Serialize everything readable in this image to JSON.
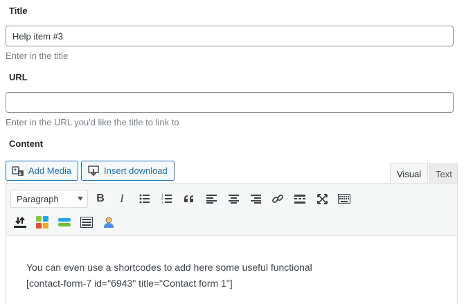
{
  "title_field": {
    "label": "Title",
    "value": "Help item #3",
    "hint": "Enter in the title"
  },
  "url_field": {
    "label": "URL",
    "value": "",
    "hint": "Enter in the URL you'd like the title to link to"
  },
  "content_field": {
    "label": "Content"
  },
  "media_buttons": {
    "add_media": "Add Media",
    "insert_download": "Insert download"
  },
  "editor_tabs": {
    "visual": "Visual",
    "text": "Text",
    "active": "visual"
  },
  "toolbar": {
    "format_select": "Paragraph",
    "row1_icons": [
      "bold-icon",
      "italic-icon",
      "bulleted-list-icon",
      "numbered-list-icon",
      "blockquote-icon",
      "align-left-icon",
      "align-center-icon",
      "align-right-icon",
      "link-icon",
      "read-more-icon",
      "fullscreen-icon",
      "toolbar-toggle-icon"
    ],
    "row2_icons": [
      "insert-download-icon",
      "shortcode-colors-icon",
      "shortcode-bar-icon",
      "shortcode-list-icon",
      "user-shortcode-icon"
    ],
    "bold_label": "B",
    "italic_label": "I",
    "quote_label": "“"
  },
  "editor_content": {
    "line1": "You can even use a shortcodes to add here some useful functional",
    "line2": "[contact-form-7 id=\"6943\" title=\"Contact form 1\"]"
  },
  "colors": {
    "accent": "#2271b1",
    "text": "#23282d",
    "hint": "#777f87",
    "toolbar_bg": "#f6f7f7"
  }
}
